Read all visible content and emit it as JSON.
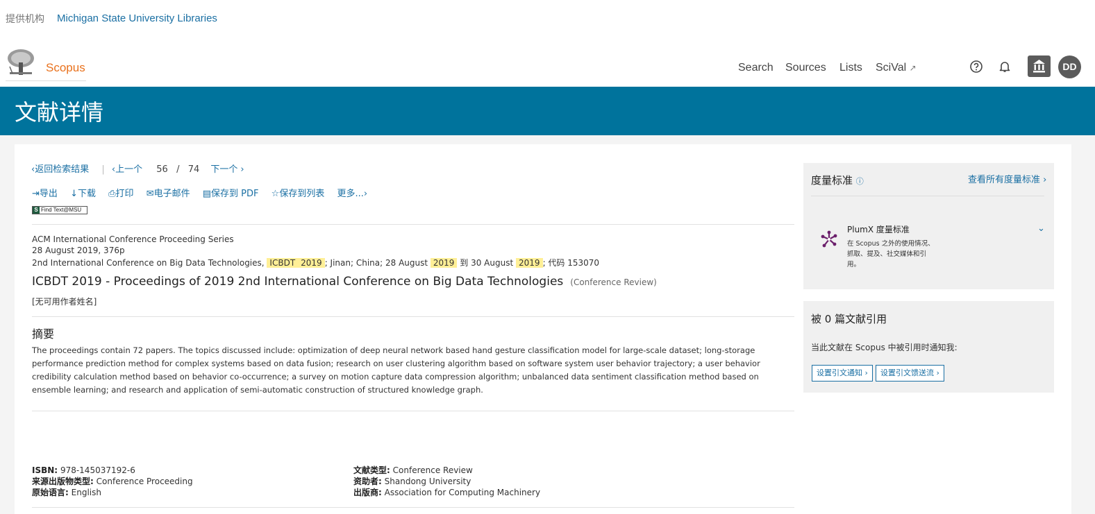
{
  "institution": {
    "label": "提供机构",
    "name": "Michigan State University Libraries"
  },
  "brand": "Scopus",
  "nav": {
    "search": "Search",
    "sources": "Sources",
    "lists": "Lists",
    "scival": "SciVal",
    "scival_ext": "↗"
  },
  "avatar": "DD",
  "banner_title": "文献详情",
  "pager": {
    "back": "返回检索结果",
    "prev": "上一个",
    "current": "56",
    "slash": "/",
    "total": "74",
    "next": "下一个"
  },
  "actions": {
    "export": "导出",
    "download": "下载",
    "print": "打印",
    "email": "电子邮件",
    "save_pdf": "保存到 PDF",
    "save_list": "保存到列表",
    "more": "更多..."
  },
  "findtext": {
    "badge": "S",
    "label": "Find Text@MSU"
  },
  "meta": {
    "series": "ACM International Conference Proceeding Series",
    "date_pages": "28 August 2019, 376p",
    "conf_prefix": "2nd International Conference on Big Data Technologies,",
    "conf_hl1": "ICBDT",
    "conf_hl2": "2019",
    "conf_mid1": "; Jinan; China; 28 August",
    "conf_hl3": "2019",
    "conf_mid2": "到 30 August",
    "conf_hl4": "2019",
    "conf_suffix": "; 代码 153070"
  },
  "title": "ICBDT 2019 - Proceedings of 2019 2nd International Conference on Big Data Technologies",
  "doc_type_label": "(Conference Review)",
  "authors": "[无可用作者姓名]",
  "abstract": {
    "heading": "摘要",
    "text": "The proceedings contain 72 papers. The topics discussed include: optimization of deep neural network based hand gesture classification model for large-scale dataset; long-storage performance prediction method for complex systems based on data fusion; research on user clustering algorithm based on software system user behavior trajectory; a user behavior credibility calculation method based on behavior co-occurrence; a survey on motion capture data compression algorithm; unbalanced data sentiment classification method based on ensemble learning; and research and application of semi-automatic construction of structured knowledge graph."
  },
  "info_left": [
    {
      "label": "ISBN:",
      "value": "978-145037192-6"
    },
    {
      "label": "来源出版物类型:",
      "value": "Conference Proceeding"
    },
    {
      "label": "原始语言:",
      "value": "English"
    }
  ],
  "info_right": [
    {
      "label": "文献类型:",
      "value": "Conference Review"
    },
    {
      "label": "资助者:",
      "value": "Shandong University"
    },
    {
      "label": "出版商:",
      "value": "Association for Computing Machinery"
    }
  ],
  "metrics": {
    "heading": "度量标准",
    "view_all": "查看所有度量标准",
    "plumx_title": "PlumX 度量标准",
    "plumx_desc": "在 Scopus 之外的使用情况、抓取、提及、社交媒体和引用。"
  },
  "cited": {
    "heading": "被 0 篇文献引用",
    "notify_text": "当此文献在 Scopus 中被引用时通知我:",
    "alert_btn": "设置引文通知",
    "feed_btn": "设置引文馈送流"
  }
}
